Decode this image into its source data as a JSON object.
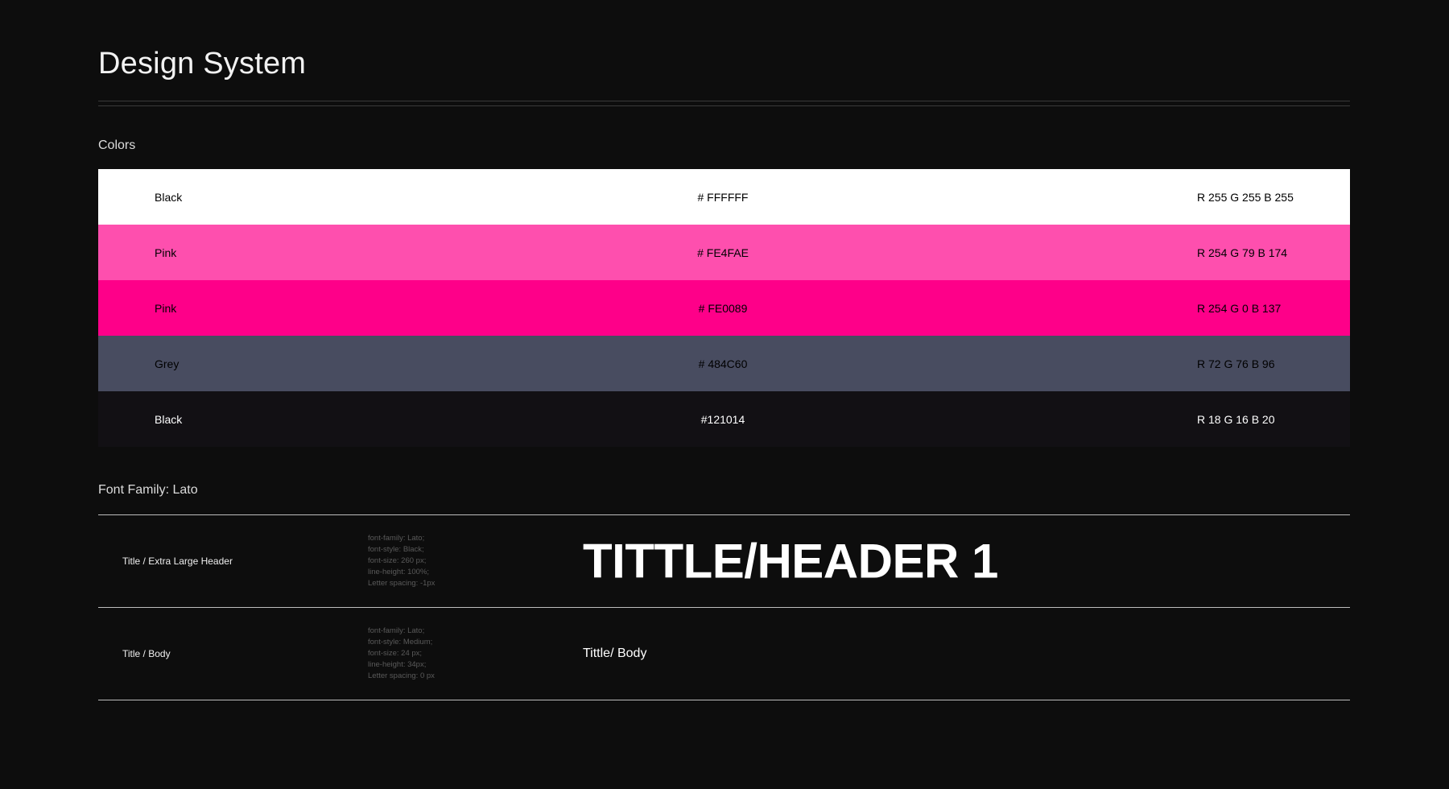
{
  "page": {
    "title": "Design System"
  },
  "colors_section": {
    "label": "Colors",
    "swatches": [
      {
        "name": "Black",
        "hex": "# FFFFFF",
        "rgb": "R 255 G 255 B 255",
        "color": "#FFFFFF",
        "text_color": "#000000"
      },
      {
        "name": "Pink",
        "hex": "# FE4FAE",
        "rgb": "R 254 G 79 B 174",
        "color": "#FE4FAE",
        "text_color": "#000000"
      },
      {
        "name": "Pink",
        "hex": "# FE0089",
        "rgb": "R 254 G 0 B 137",
        "color": "#FE0089",
        "text_color": "#000000"
      },
      {
        "name": "Grey",
        "hex": "# 484C60",
        "rgb": "R 72 G 76 B 96",
        "color": "#484C60",
        "text_color": "#000000"
      },
      {
        "name": "Black",
        "hex": "#121014",
        "rgb": "R 18 G 16 B 20",
        "color": "#121014",
        "text_color": "#FFFFFF"
      }
    ]
  },
  "typography_section": {
    "label": "Font Family: Lato",
    "styles": [
      {
        "name": "Title / Extra Large Header",
        "specs": [
          "font-family: Lato;",
          "font-style: Black;",
          "font-size: 260 px;",
          "line-height: 100%;",
          "Letter spacing: -1px"
        ],
        "sample": "TITTLE/HEADER 1"
      },
      {
        "name": "Title / Body",
        "specs": [
          "font-family: Lato;",
          "font-style: Medium;",
          "font-size: 24 px;",
          "line-height: 34px;",
          "Letter spacing: 0 px"
        ],
        "sample": "Tittle/ Body"
      }
    ]
  }
}
